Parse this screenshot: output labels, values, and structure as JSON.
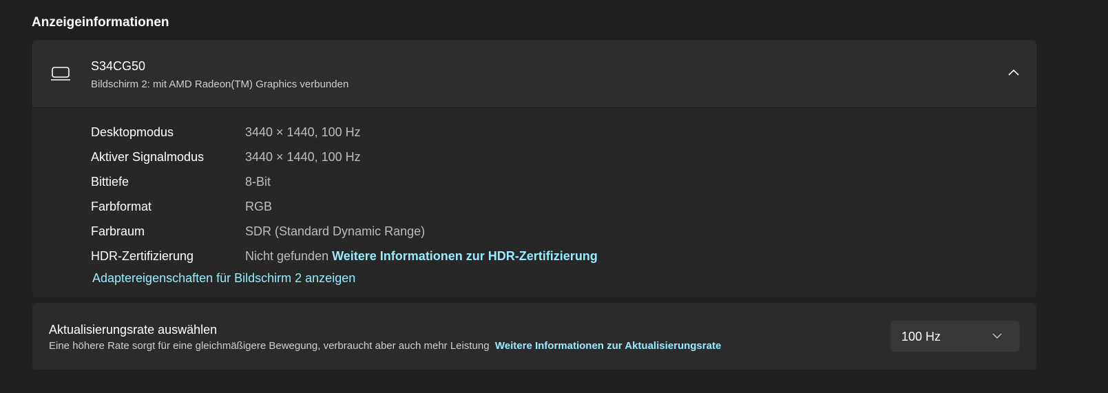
{
  "section_title": "Anzeigeinformationen",
  "display": {
    "name": "S34CG50",
    "subtitle": "Bildschirm 2: mit AMD Radeon(TM) Graphics verbunden",
    "rows": [
      {
        "label": "Desktopmodus",
        "value": "3440 × 1440, 100 Hz"
      },
      {
        "label": "Aktiver Signalmodus",
        "value": "3440 × 1440, 100 Hz"
      },
      {
        "label": "Bittiefe",
        "value": "8-Bit"
      },
      {
        "label": "Farbformat",
        "value": "RGB"
      },
      {
        "label": "Farbraum",
        "value": "SDR (Standard Dynamic Range)"
      },
      {
        "label": "HDR-Zertifizierung",
        "value": "Nicht gefunden",
        "link": "Weitere Informationen zur HDR-Zertifizierung"
      }
    ],
    "adapter_link": "Adaptereigenschaften für Bildschirm 2 anzeigen"
  },
  "refresh": {
    "title": "Aktualisierungsrate auswählen",
    "description": "Eine höhere Rate sorgt für eine gleichmäßigere Bewegung, verbraucht aber auch mehr Leistung",
    "link": "Weitere Informationen zur Aktualisierungsrate",
    "selected": "100 Hz"
  },
  "colors": {
    "accent_link": "#99ebff",
    "background": "#202020",
    "card": "#2b2b2b"
  }
}
